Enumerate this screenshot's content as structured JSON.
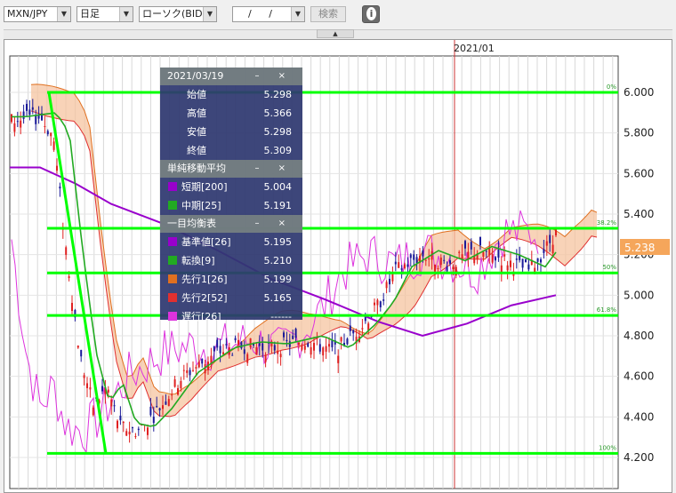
{
  "toolbar": {
    "currency_pair": "MXN/JPY",
    "period": "日足",
    "chart_type": "ローソク(BID)",
    "date_input": "/ /",
    "search_label": "検索",
    "info_label": "i"
  },
  "chart": {
    "date_label": "2021/01",
    "current_price": "5.238",
    "y_ticks": [
      "6.000",
      "5.800",
      "5.600",
      "5.400",
      "5.200",
      "5.000",
      "4.800",
      "4.600",
      "4.400",
      "4.200"
    ],
    "fib_labels": [
      "0%",
      "38.2%",
      "50%",
      "61.8%",
      "100%"
    ],
    "colors": {
      "fib_lines": "#00ff00",
      "sma_short": "#9900cc",
      "sma_mid": "#22aa22",
      "ichimoku_lead1": "#e07020",
      "ichimoku_lead2": "#e03030",
      "lagging": "#dd33dd",
      "candle_up": "#e02020",
      "candle_down": "#1a1a99",
      "current_price_bg": "#f5a65b",
      "vertical_marker": "#cc3333"
    }
  },
  "panel": {
    "date": "2021/03/19",
    "ohlc": [
      {
        "label": "始値",
        "value": "5.298"
      },
      {
        "label": "高値",
        "value": "5.366"
      },
      {
        "label": "安値",
        "value": "5.298"
      },
      {
        "label": "終値",
        "value": "5.309"
      }
    ],
    "sma_title": "単純移動平均",
    "sma": [
      {
        "label": "短期[200]",
        "value": "5.004",
        "color": "#9900cc"
      },
      {
        "label": "中期[25]",
        "value": "5.191",
        "color": "#22aa22"
      }
    ],
    "ichimoku_title": "一目均衡表",
    "ichimoku": [
      {
        "label": "基準値[26]",
        "value": "5.195",
        "color": "#9900cc"
      },
      {
        "label": "転換[9]",
        "value": "5.210",
        "color": "#22aa22"
      },
      {
        "label": "先行1[26]",
        "value": "5.199",
        "color": "#e07020"
      },
      {
        "label": "先行2[52]",
        "value": "5.165",
        "color": "#e03030"
      },
      {
        "label": "遅行[26]",
        "value": "------",
        "color": "#dd33dd"
      }
    ],
    "controls": "– ×"
  }
}
